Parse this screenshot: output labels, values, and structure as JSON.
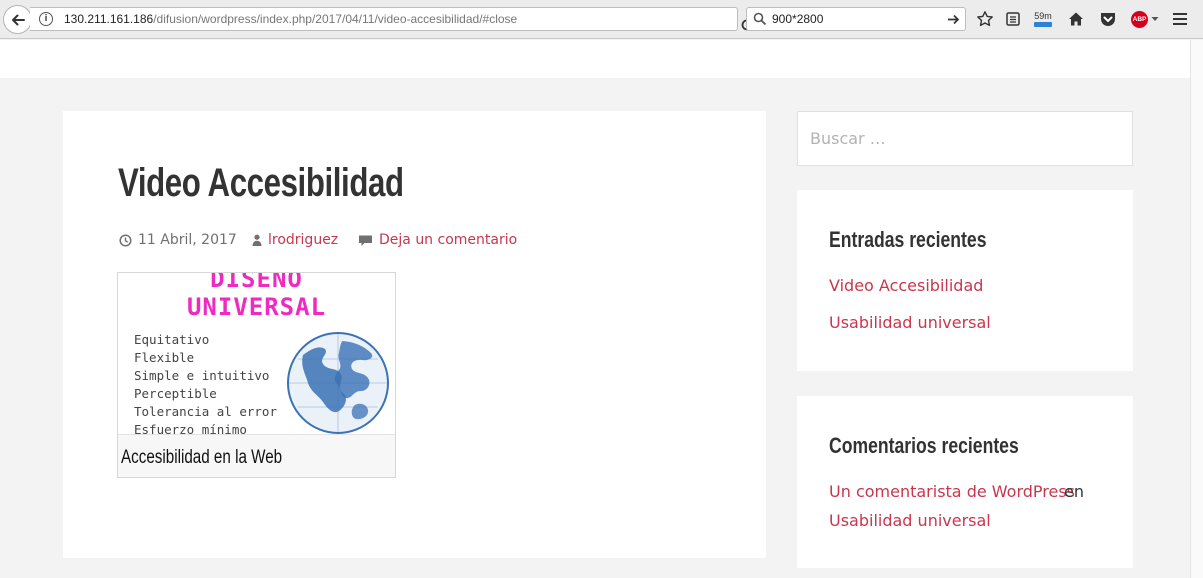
{
  "browser": {
    "url_host": "130.211.161.186",
    "url_path": "/difusion/wordpress/index.php/2017/04/11/video-accesibilidad/#close",
    "search_value": "900*2800",
    "time_badge": "59m",
    "adblock_label": "ABP"
  },
  "search": {
    "placeholder": "Buscar …"
  },
  "post": {
    "title": "Video Accesibilidad",
    "date": "11 Abril, 2017",
    "author": "lrodriguez",
    "comment_link": "Deja un comentario",
    "thumbnail": {
      "heading_1": "DISEÑO",
      "heading_2": "UNIVERSAL",
      "lines": [
        "Equitativo",
        "Flexible",
        "Simple e intuitivo",
        "Perceptible",
        "Tolerancia al error",
        "Esfuerzo mínimo"
      ],
      "caption": "Accesibilidad en la Web"
    }
  },
  "recent_posts": {
    "title": "Entradas recientes",
    "items": [
      "Video Accesibilidad",
      "Usabilidad universal"
    ]
  },
  "recent_comments": {
    "title": "Comentarios recientes",
    "author": "Un comentarista de WordPress",
    "connector": "en",
    "post": "Usabilidad universal"
  },
  "colors": {
    "link": "#c9364d",
    "heading_pink": "#ee2ac1",
    "globe_blue": "#3b72b5"
  }
}
